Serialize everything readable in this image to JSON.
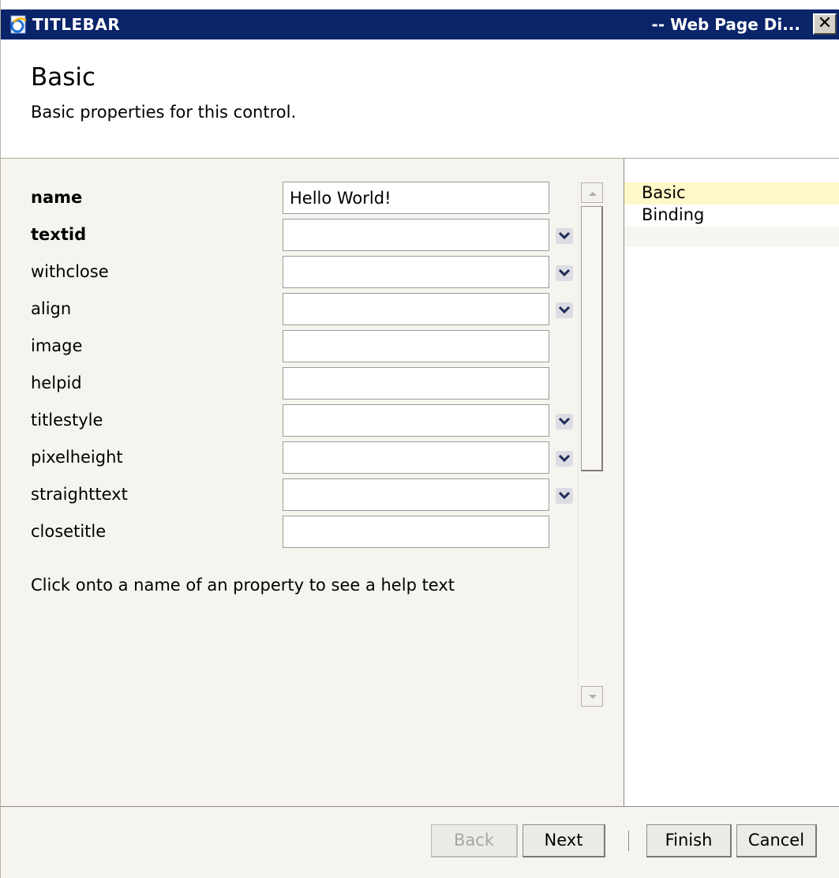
{
  "window": {
    "title": "TITLEBAR",
    "title_right": "-- Web Page Di...",
    "close_glyph": "✕"
  },
  "header": {
    "title": "Basic",
    "subtitle": "Basic properties for this control."
  },
  "properties": [
    {
      "label": "name",
      "bold": true,
      "value": "Hello World!",
      "dropdown": false
    },
    {
      "label": "textid",
      "bold": true,
      "value": "",
      "dropdown": true
    },
    {
      "label": "withclose",
      "bold": false,
      "value": "",
      "dropdown": true
    },
    {
      "label": "align",
      "bold": false,
      "value": "",
      "dropdown": true
    },
    {
      "label": "image",
      "bold": false,
      "value": "",
      "dropdown": false
    },
    {
      "label": "helpid",
      "bold": false,
      "value": "",
      "dropdown": false
    },
    {
      "label": "titlestyle",
      "bold": false,
      "value": "",
      "dropdown": true
    },
    {
      "label": "pixelheight",
      "bold": false,
      "value": "",
      "dropdown": true
    },
    {
      "label": "straighttext",
      "bold": false,
      "value": "",
      "dropdown": true
    },
    {
      "label": "closetitle",
      "bold": false,
      "value": "",
      "dropdown": false
    }
  ],
  "help_text": "Click onto a name of an property to see a help text",
  "nav": {
    "items": [
      {
        "label": "Basic",
        "active": true
      },
      {
        "label": "Binding",
        "active": false
      }
    ]
  },
  "footer": {
    "back_label": "Back",
    "next_label": "Next",
    "finish_label": "Finish",
    "cancel_label": "Cancel"
  },
  "colors": {
    "titlebar": "#0a246a",
    "panel": "#f5f4ee",
    "nav_active": "#fff8c8"
  },
  "icons": {
    "titlebar": "ie-page-icon",
    "close": "close-icon",
    "dropdown": "chevron-down-icon",
    "scroll_up": "scroll-up-arrow-icon",
    "scroll_down": "scroll-down-arrow-icon"
  }
}
